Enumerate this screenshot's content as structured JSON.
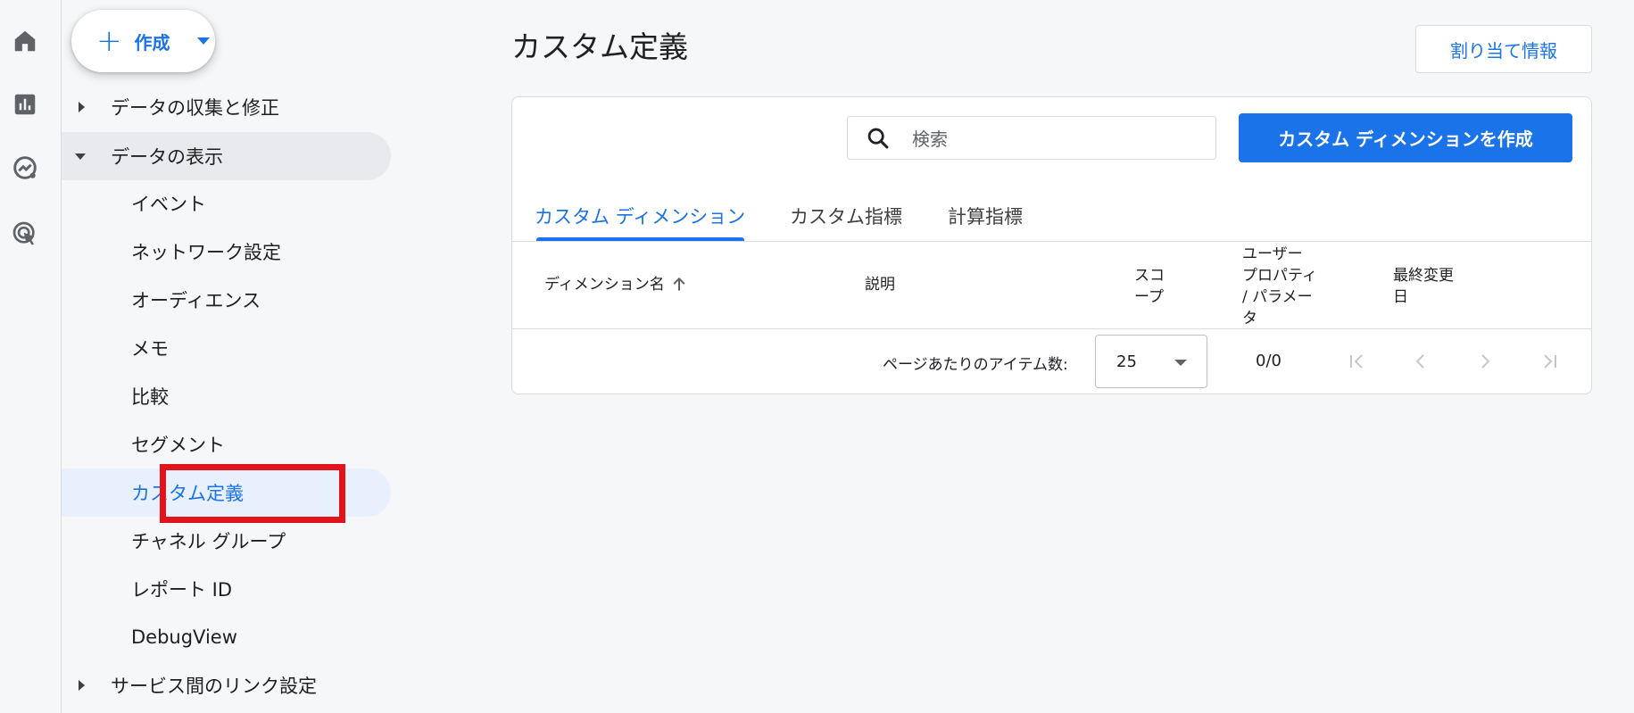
{
  "rail": {
    "icons": [
      "home-icon",
      "reports-icon",
      "explore-icon",
      "advertising-icon"
    ]
  },
  "nav": {
    "create_label": "作成",
    "sections": {
      "collect": "データの収集と修正",
      "display": "データの表示",
      "links": "サービス間のリンク設定"
    },
    "items": [
      "イベント",
      "ネットワーク設定",
      "オーディエンス",
      "メモ",
      "比較",
      "セグメント",
      "カスタム定義",
      "チャネル グループ",
      "レポート ID",
      "DebugView"
    ]
  },
  "main": {
    "title": "カスタム定義",
    "assign_button": "割り当て情報",
    "search_placeholder": "検索",
    "create_dimension_button": "カスタム ディメンションを作成",
    "tabs": [
      "カスタム ディメンション",
      "カスタム指標",
      "計算指標"
    ],
    "table": {
      "headers": {
        "name": "ディメンション名",
        "description": "説明",
        "scope_line1": "スコ",
        "scope_line2": "ープ",
        "prop_line1": "ユーザー",
        "prop_line2": "プロパティ",
        "prop_line3": "/ パラメー",
        "prop_line4": "タ",
        "modified_line1": "最終変更",
        "modified_line2": "日"
      }
    },
    "pager": {
      "label": "ページあたりのアイテム数:",
      "per_page": "25",
      "count": "0/0"
    }
  },
  "colors": {
    "accent": "#1a73e8",
    "highlight": "#e3131b"
  }
}
